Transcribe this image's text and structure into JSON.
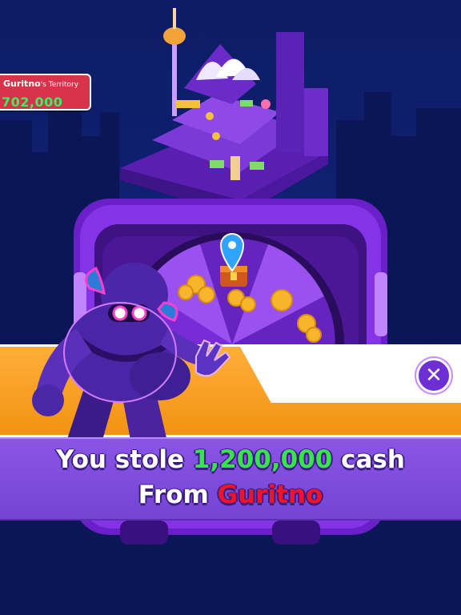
{
  "colors": {
    "sky": "#102073",
    "machine_purple": "#7a2bd8",
    "banner_orange": "#f29312",
    "panel_purple": "#7b49dc",
    "badge_red": "#d8334a",
    "cash_green": "#39e24f",
    "victim_red": "#f0142a"
  },
  "territory": {
    "owner": "Guritno",
    "suffix": "'s Territory",
    "value": "702,000"
  },
  "close_button": {
    "icon": "close-icon"
  },
  "message": {
    "line1_prefix": "You stole",
    "amount": "1,200,000",
    "line1_suffix": "cash",
    "line2_prefix": "From",
    "victim": "Guritno"
  },
  "icons": [
    "map-pin-icon",
    "coin-icon",
    "close-icon"
  ]
}
